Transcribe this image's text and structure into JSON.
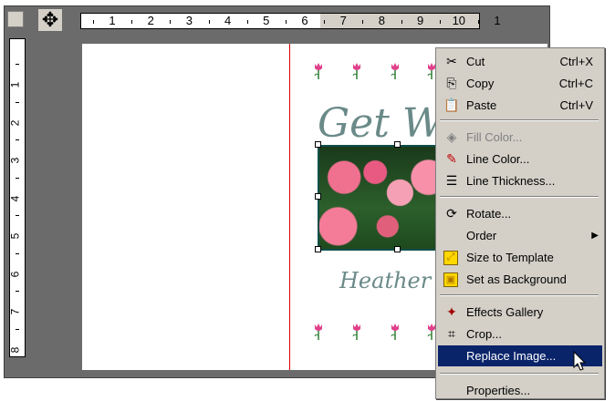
{
  "ruler": {
    "horizontal": [
      "1",
      "2",
      "3",
      "4",
      "5",
      "6",
      "7",
      "8",
      "9",
      "10",
      "1"
    ],
    "vertical": [
      "1",
      "2",
      "3",
      "4",
      "5",
      "6",
      "7",
      "8"
    ]
  },
  "card": {
    "greeting": "Get We",
    "signature": "Heather"
  },
  "menu": {
    "items": [
      {
        "id": "cut",
        "label": "Cut",
        "shortcut": "Ctrl+X",
        "icon": "scissors-icon",
        "enabled": true
      },
      {
        "id": "copy",
        "label": "Copy",
        "shortcut": "Ctrl+C",
        "icon": "copy-icon",
        "enabled": true
      },
      {
        "id": "paste",
        "label": "Paste",
        "shortcut": "Ctrl+V",
        "icon": "paste-icon",
        "enabled": true
      },
      {
        "id": "fill-color",
        "label": "Fill Color...",
        "shortcut": "",
        "icon": "fill-color-icon",
        "enabled": false
      },
      {
        "id": "line-color",
        "label": "Line Color...",
        "shortcut": "",
        "icon": "line-color-icon",
        "enabled": true
      },
      {
        "id": "line-thickness",
        "label": "Line Thickness...",
        "shortcut": "",
        "icon": "line-thickness-icon",
        "enabled": true
      },
      {
        "id": "rotate",
        "label": "Rotate...",
        "shortcut": "",
        "icon": "rotate-icon",
        "enabled": true
      },
      {
        "id": "order",
        "label": "Order",
        "shortcut": "",
        "icon": "",
        "enabled": true,
        "submenu": true
      },
      {
        "id": "size-to-template",
        "label": "Size to Template",
        "shortcut": "",
        "icon": "size-to-template-icon",
        "enabled": true
      },
      {
        "id": "set-as-background",
        "label": "Set as Background",
        "shortcut": "",
        "icon": "set-background-icon",
        "enabled": true
      },
      {
        "id": "effects-gallery",
        "label": "Effects Gallery",
        "shortcut": "",
        "icon": "effects-gallery-icon",
        "enabled": true
      },
      {
        "id": "crop",
        "label": "Crop...",
        "shortcut": "",
        "icon": "crop-icon",
        "enabled": true
      },
      {
        "id": "replace-image",
        "label": "Replace Image...",
        "shortcut": "",
        "icon": "",
        "enabled": true,
        "selected": true
      },
      {
        "id": "properties",
        "label": "Properties...",
        "shortcut": "",
        "icon": "",
        "enabled": true
      }
    ]
  },
  "colors": {
    "menu_bg": "#d4d0c8",
    "highlight": "#0a246a",
    "fold_line": "#e00000",
    "tulip": "#e0408a",
    "script_text": "#6a8a88"
  }
}
